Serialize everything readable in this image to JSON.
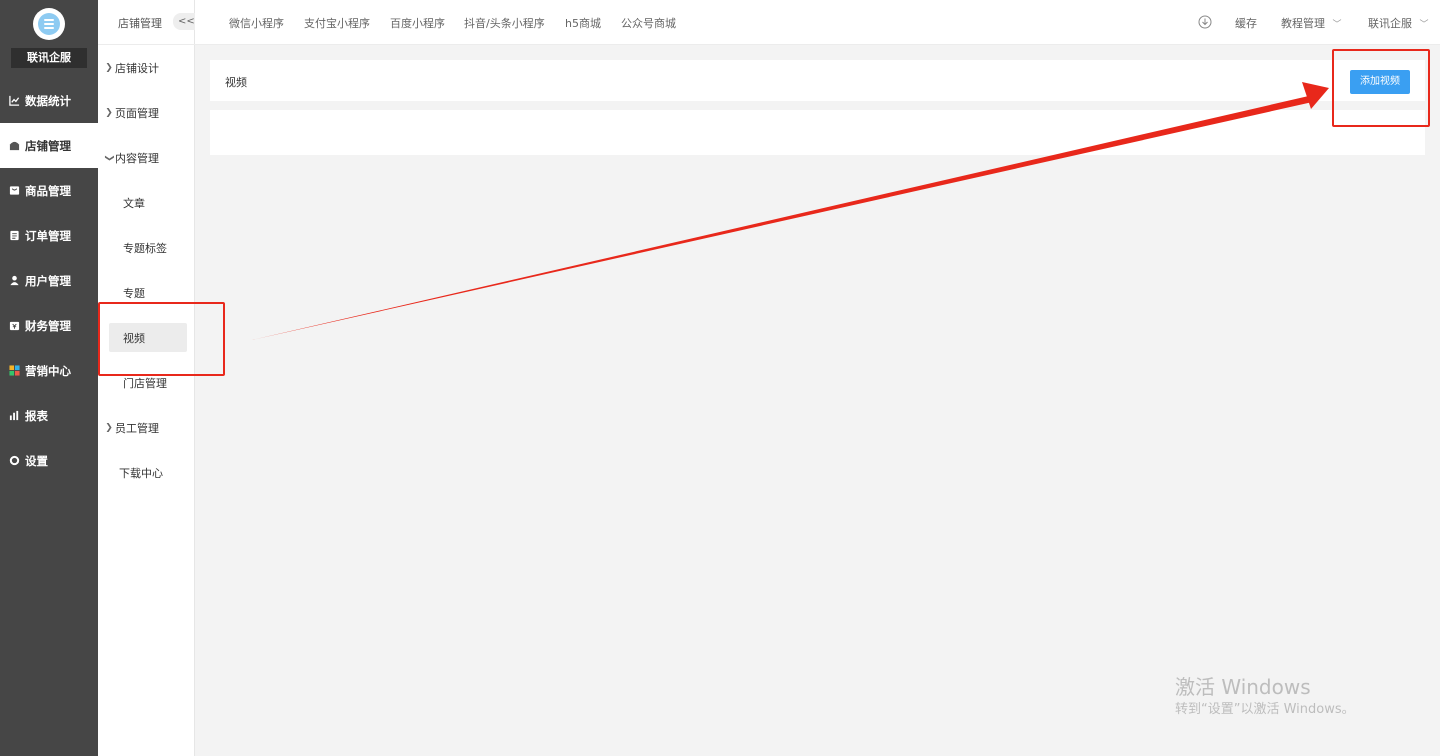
{
  "brand": {
    "name": "联讯企服"
  },
  "nav": [
    {
      "label": "数据统计",
      "icon": "line-chart-icon"
    },
    {
      "label": "店铺管理",
      "icon": "shop-icon"
    },
    {
      "label": "商品管理",
      "icon": "box-icon"
    },
    {
      "label": "订单管理",
      "icon": "order-icon"
    },
    {
      "label": "用户管理",
      "icon": "user-icon"
    },
    {
      "label": "财务管理",
      "icon": "finance-icon"
    },
    {
      "label": "营销中心",
      "icon": "marketing-icon"
    },
    {
      "label": "报表",
      "icon": "bar-chart-icon"
    },
    {
      "label": "设置",
      "icon": "gear-icon"
    }
  ],
  "subnav": {
    "title": "店铺管理",
    "collapse": "<<",
    "items": [
      {
        "label": "店铺设计"
      },
      {
        "label": "页面管理"
      },
      {
        "label": "内容管理"
      },
      {
        "label": "文章"
      },
      {
        "label": "专题标签"
      },
      {
        "label": "专题"
      },
      {
        "label": "视频"
      },
      {
        "label": "门店管理"
      },
      {
        "label": "员工管理"
      },
      {
        "label": "下载中心"
      }
    ]
  },
  "topbar": {
    "tabs": [
      {
        "label": "微信小程序"
      },
      {
        "label": "支付宝小程序"
      },
      {
        "label": "百度小程序"
      },
      {
        "label": "抖音/头条小程序"
      },
      {
        "label": "h5商城"
      },
      {
        "label": "公众号商城"
      }
    ],
    "cache": "缓存",
    "tutorial": "教程管理",
    "account": "联讯企服"
  },
  "content": {
    "title": "视频",
    "add_button": "添加视频"
  },
  "watermark": {
    "line1": "激活 Windows",
    "line2": "转到“设置”以激活 Windows。"
  },
  "colors": {
    "sidebar_bg": "#464646",
    "primary": "#3a9ff2",
    "annotation": "#e8281b"
  }
}
